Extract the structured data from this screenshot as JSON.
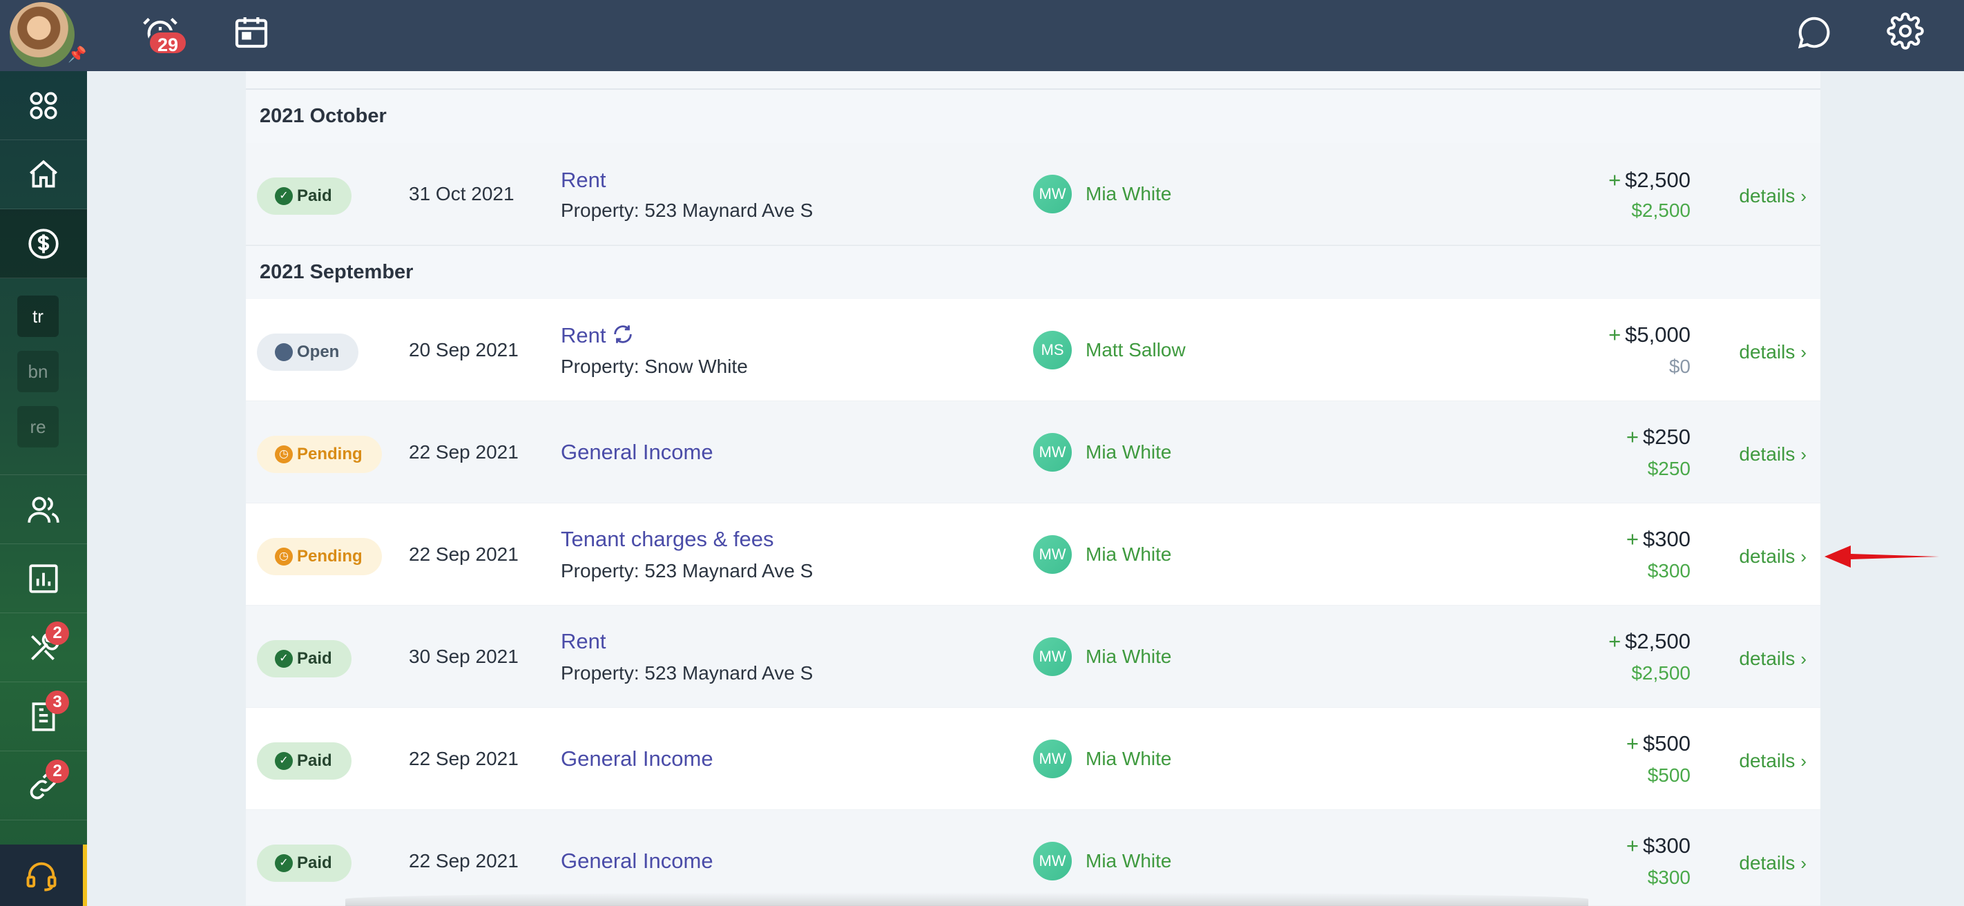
{
  "topbar": {
    "notifications_count": "29"
  },
  "sidebar": {
    "badges": {
      "maintenance": "2",
      "documents": "3",
      "integrations": "2"
    },
    "workspaces": [
      "tr",
      "bn",
      "re"
    ]
  },
  "top_section_visible": true,
  "months": [
    {
      "label": "2021 October"
    },
    {
      "label": "2021 September"
    }
  ],
  "rows": [
    {
      "status": "Paid",
      "date": "31 Oct 2021",
      "title": "Rent",
      "subtitle": "Property: 523 Maynard Ave S",
      "initials": "MW",
      "person": "Mia White",
      "amount": "$2,500",
      "paid": "$2,500",
      "details": "details"
    },
    {
      "status": "Open",
      "date": "20 Sep 2021",
      "title": "Rent",
      "subtitle": "Property: Snow White",
      "initials": "MS",
      "person": "Matt Sallow",
      "amount": "$5,000",
      "paid": "$0",
      "details": "details"
    },
    {
      "status": "Pending",
      "date": "22 Sep 2021",
      "title": "General Income",
      "subtitle": "",
      "initials": "MW",
      "person": "Mia White",
      "amount": "$250",
      "paid": "$250",
      "details": "details"
    },
    {
      "status": "Pending",
      "date": "22 Sep 2021",
      "title": "Tenant charges & fees",
      "subtitle": "Property: 523 Maynard Ave S",
      "initials": "MW",
      "person": "Mia White",
      "amount": "$300",
      "paid": "$300",
      "details": "details"
    },
    {
      "status": "Paid",
      "date": "30 Sep 2021",
      "title": "Rent",
      "subtitle": "Property: 523 Maynard Ave S",
      "initials": "MW",
      "person": "Mia White",
      "amount": "$2,500",
      "paid": "$2,500",
      "details": "details"
    },
    {
      "status": "Paid",
      "date": "22 Sep 2021",
      "title": "General Income",
      "subtitle": "",
      "initials": "MW",
      "person": "Mia White",
      "amount": "$500",
      "paid": "$500",
      "details": "details"
    },
    {
      "status": "Paid",
      "date": "22 Sep 2021",
      "title": "General Income",
      "subtitle": "",
      "initials": "MW",
      "person": "Mia White",
      "amount": "$300",
      "paid": "$300",
      "details": "details"
    }
  ],
  "amount_prefix": "+",
  "colors": {
    "topbar": "#34455c",
    "paid": "#24743b",
    "pending": "#e8941f",
    "open": "#4d6380",
    "link": "#4a4ca8",
    "accent_green": "#3f9a3f",
    "annotation_arrow": "#e0141a"
  }
}
